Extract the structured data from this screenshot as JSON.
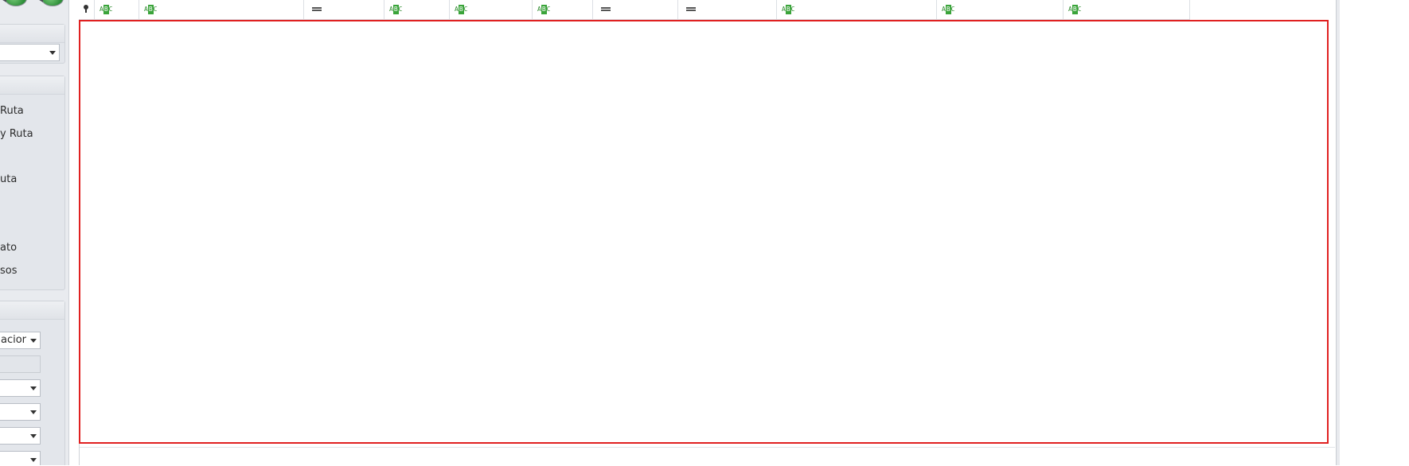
{
  "left_panel": {
    "combo_top": {
      "value": ""
    },
    "links": [
      {
        "label": "Ruta"
      },
      {
        "label": "y Ruta"
      },
      {
        "label": "uta"
      },
      {
        "label": "ato"
      },
      {
        "label": "sos"
      }
    ],
    "filters": {
      "order_select": {
        "value": "acior"
      },
      "disabled_field": {
        "value": ""
      },
      "select_1": {
        "value": ""
      },
      "select_2": {
        "value": ""
      },
      "select_3": {
        "value": ""
      },
      "select_4": {
        "value": ""
      }
    }
  },
  "grid": {
    "columns": [
      {
        "type_icon": "pin-icon"
      },
      {
        "type_icon": "text-abc-icon"
      },
      {
        "type_icon": "text-abc-icon"
      },
      {
        "type_icon": "equals-icon"
      },
      {
        "type_icon": "text-abc-icon"
      },
      {
        "type_icon": "text-abc-icon"
      },
      {
        "type_icon": "text-abc-icon"
      },
      {
        "type_icon": "equals-icon"
      },
      {
        "type_icon": "equals-icon"
      },
      {
        "type_icon": "text-abc-icon"
      },
      {
        "type_icon": "text-abc-icon"
      },
      {
        "type_icon": "text-abc-icon"
      },
      {
        "type_icon": "none"
      }
    ],
    "rows": [],
    "highlight_color": "#e02020"
  }
}
